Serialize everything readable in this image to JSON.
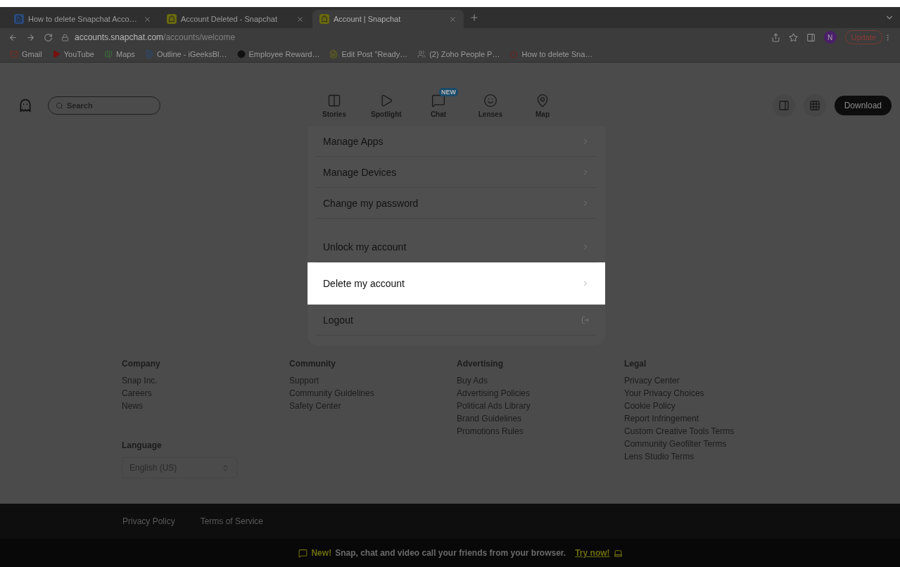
{
  "browser": {
    "tabs": [
      {
        "title": "How to delete Snapchat Acco…",
        "selected": false
      },
      {
        "title": "Account Deleted - Snapchat",
        "selected": false
      },
      {
        "title": "Account | Snapchat",
        "selected": true
      }
    ],
    "url": {
      "host": "accounts.snapchat.com",
      "path": "/accounts/welcome"
    },
    "profile": "N",
    "update": "Update",
    "bookmarks": [
      "Gmail",
      "YouTube",
      "Maps",
      "Outline - iGeeksBl…",
      "Employee Reward…",
      "Edit Post \"Ready…",
      "(2) Zoho People P…",
      "How to delete Sna…"
    ]
  },
  "header": {
    "search": {
      "placeholder": "Search"
    },
    "nav": [
      {
        "label": "Stories"
      },
      {
        "label": "Spotlight"
      },
      {
        "label": "Chat",
        "badge": "NEW"
      },
      {
        "label": "Lenses"
      },
      {
        "label": "Map"
      }
    ],
    "download": "Download"
  },
  "settings": [
    {
      "group": [
        {
          "label": "Manage Apps",
          "kind": "link",
          "highlighted": false
        },
        {
          "label": "Manage Devices",
          "kind": "link",
          "highlighted": false
        },
        {
          "label": "Change my password",
          "kind": "link",
          "highlighted": false
        }
      ]
    },
    {
      "group": [
        {
          "label": "Unlock my account",
          "kind": "link",
          "highlighted": false
        },
        {
          "label": "Delete my account",
          "kind": "link",
          "highlighted": true
        },
        {
          "label": "Logout",
          "kind": "logout",
          "highlighted": false
        }
      ]
    }
  ],
  "footer": {
    "columns": [
      {
        "heading": "Company",
        "links": [
          "Snap Inc.",
          "Careers",
          "News"
        ]
      },
      {
        "heading": "Community",
        "links": [
          "Support",
          "Community Guidelines",
          "Safety Center"
        ]
      },
      {
        "heading": "Advertising",
        "links": [
          "Buy Ads",
          "Advertising Policies",
          "Political Ads Library",
          "Brand Guidelines",
          "Promotions Rules"
        ]
      },
      {
        "heading": "Legal",
        "links": [
          "Privacy Center",
          "Your Privacy Choices",
          "Cookie Policy",
          "Report Infringement",
          "Custom Creative Tools Terms",
          "Community Geofilter Terms",
          "Lens Studio Terms"
        ]
      }
    ],
    "language": {
      "heading": "Language",
      "value": "English (US)"
    },
    "bottom_links": [
      "Privacy Policy",
      "Terms of Service"
    ],
    "banner": {
      "new": "New!",
      "text": "Snap, chat and video call your friends from your browser.",
      "link": "Try now!"
    }
  }
}
